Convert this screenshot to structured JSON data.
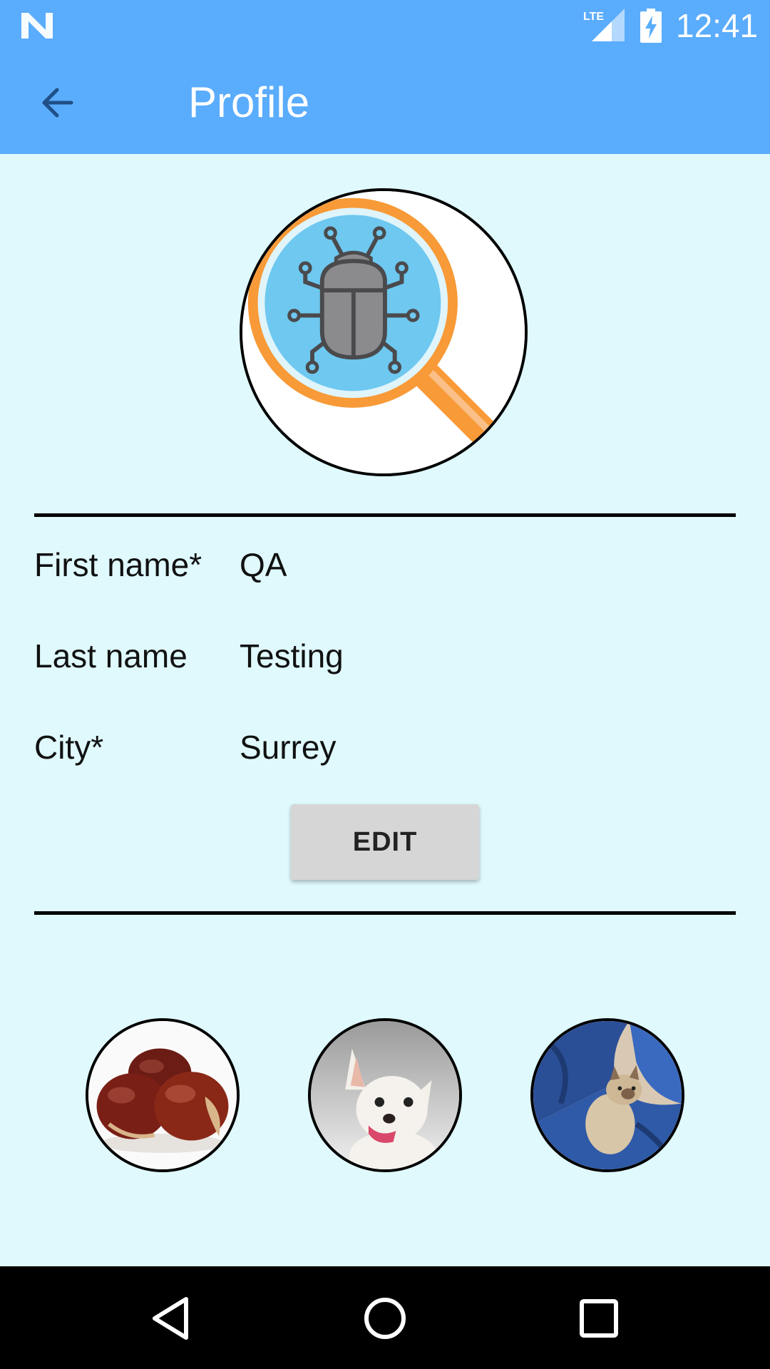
{
  "status_bar": {
    "time": "12:41",
    "network_label": "LTE",
    "icons": [
      "n-logo-icon",
      "lte-signal-icon",
      "battery-charging-icon"
    ]
  },
  "app_bar": {
    "title": "Profile",
    "back_icon": "back-arrow-icon"
  },
  "avatar": {
    "icon": "bug-magnifier-icon"
  },
  "profile": {
    "fields": [
      {
        "label": "First name*",
        "value": "QA"
      },
      {
        "label": "Last name",
        "value": "Testing"
      },
      {
        "label": "City*",
        "value": "Surrey"
      }
    ],
    "edit_label": "EDIT"
  },
  "gallery": {
    "items": [
      {
        "subject": "chestnuts"
      },
      {
        "subject": "chihuahua"
      },
      {
        "subject": "cat"
      }
    ]
  },
  "nav_bar": {
    "icons": [
      "nav-back-icon",
      "nav-home-icon",
      "nav-recents-icon"
    ]
  },
  "colors": {
    "app_bar": "#5aacfc",
    "background": "#dff9fd",
    "button": "#d6d6d6"
  }
}
